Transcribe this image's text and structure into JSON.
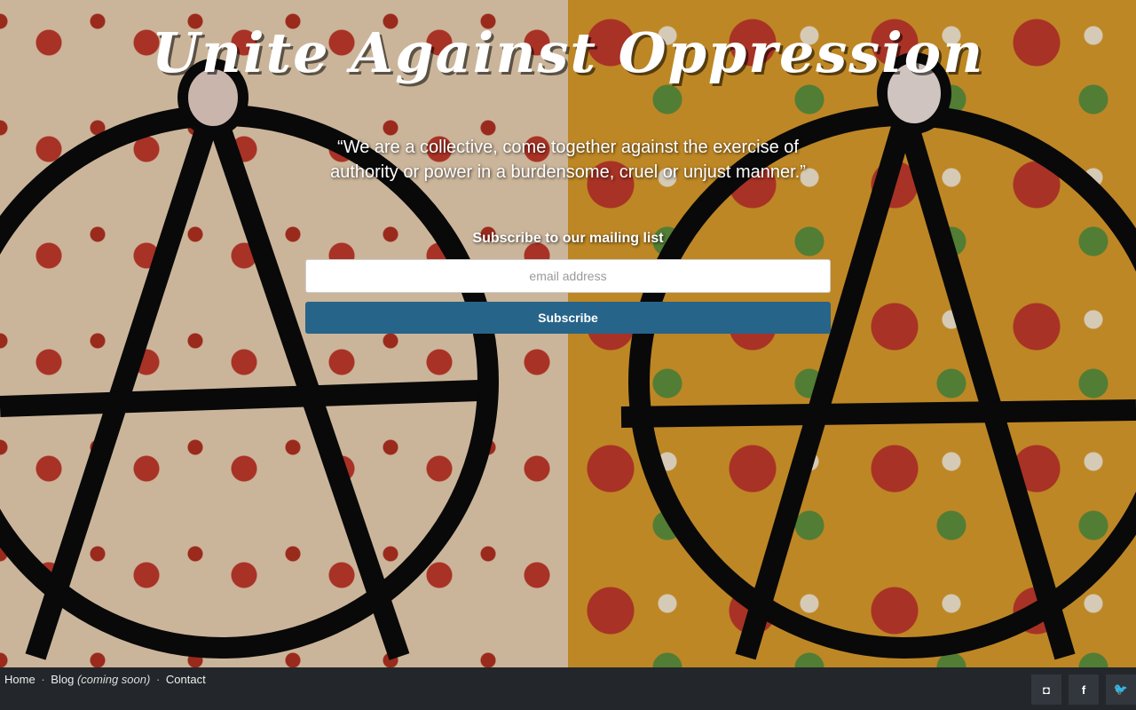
{
  "hero": {
    "title": "Unite Against Oppression",
    "quote": "“We are a collective, come together against the exercise of authority or power in a burdensome, cruel or unjust manner.”",
    "subscribe_label": "Subscribe to our mailing list",
    "email_placeholder": "email address",
    "subscribe_button": "Subscribe"
  },
  "footer": {
    "nav": {
      "home": "Home",
      "separator": "·",
      "blog": "Blog",
      "blog_note": "(coming soon)",
      "contact": "Contact"
    },
    "social": [
      {
        "icon": "instagram-icon",
        "glyph": "◘"
      },
      {
        "icon": "facebook-icon",
        "glyph": "f"
      },
      {
        "icon": "twitter-icon",
        "glyph": "🐦"
      }
    ]
  },
  "colors": {
    "accent": "#276489",
    "footer_bg": "#23272b"
  }
}
